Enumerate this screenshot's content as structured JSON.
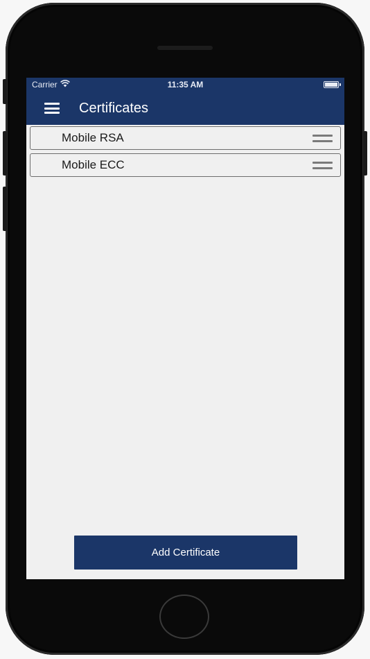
{
  "status_bar": {
    "carrier": "Carrier",
    "time": "11:35 AM",
    "wifi_icon": "wifi-icon",
    "battery_icon": "battery-icon",
    "battery_level": 1.0
  },
  "nav": {
    "title": "Certificates",
    "menu_icon": "hamburger-menu-icon"
  },
  "certificates": [
    {
      "label": "Mobile RSA",
      "handle_icon": "drag-handle-icon"
    },
    {
      "label": "Mobile ECC",
      "handle_icon": "drag-handle-icon"
    }
  ],
  "add_button": {
    "label": "Add Certificate"
  },
  "colors": {
    "brand": "#1b3668",
    "background": "#f0f0f0",
    "item_border": "#6d6d6d"
  }
}
